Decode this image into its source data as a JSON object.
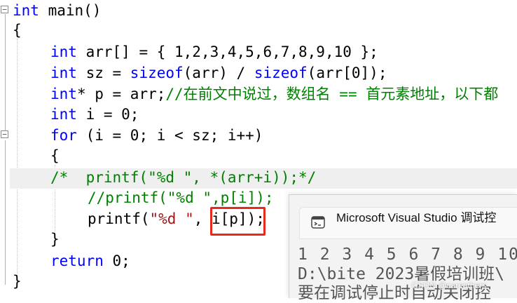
{
  "colors": {
    "keyword": "#0000ff",
    "string": "#a31515",
    "comment": "#008000",
    "highlight_box": "#e8291d"
  },
  "code": {
    "l1_kw": "int",
    "l1_rest": " main()",
    "l2": "{",
    "l3_kw": "int",
    "l3_rest": " arr[] = { 1,2,3,4,5,6,7,8,9,10 };",
    "l4_kw": "int",
    "l4_a": " sz = ",
    "l4_sizeof1": "sizeof",
    "l4_b": "(arr) / ",
    "l4_sizeof2": "sizeof",
    "l4_c": "(arr[0]);",
    "l5_kw": "int",
    "l5_rest": "* p = arr;",
    "l5_cmt": "//在前文中说过，数组名 == 首元素地址，以下都",
    "l6_kw": "int",
    "l6_rest": " i = 0;",
    "l7_kw": "for",
    "l7_rest": " (i = 0; i < sz; i++)",
    "l8": "{",
    "l9_cmt": "/*  printf(\"%d \", *(arr+i));*/",
    "l10_cmt": "//printf(\"%d \",p[i]);",
    "l11_a": "printf(",
    "l11_str": "\"%d \"",
    "l11_b": ", i[p]);",
    "l12": "}",
    "l13_kw": "return",
    "l13_rest": " 0;",
    "l14": "}"
  },
  "console": {
    "icon": "console-app-icon",
    "title": "Microsoft Visual Studio 调试控",
    "output_line": "1 2 3 4 5 6 7 8 9 10",
    "path_line": "D:\\bite 2023暑假培训班\\",
    "partial_line": "要在调试停止时自动关闭控"
  },
  "watermark": "CSDN @careathers"
}
